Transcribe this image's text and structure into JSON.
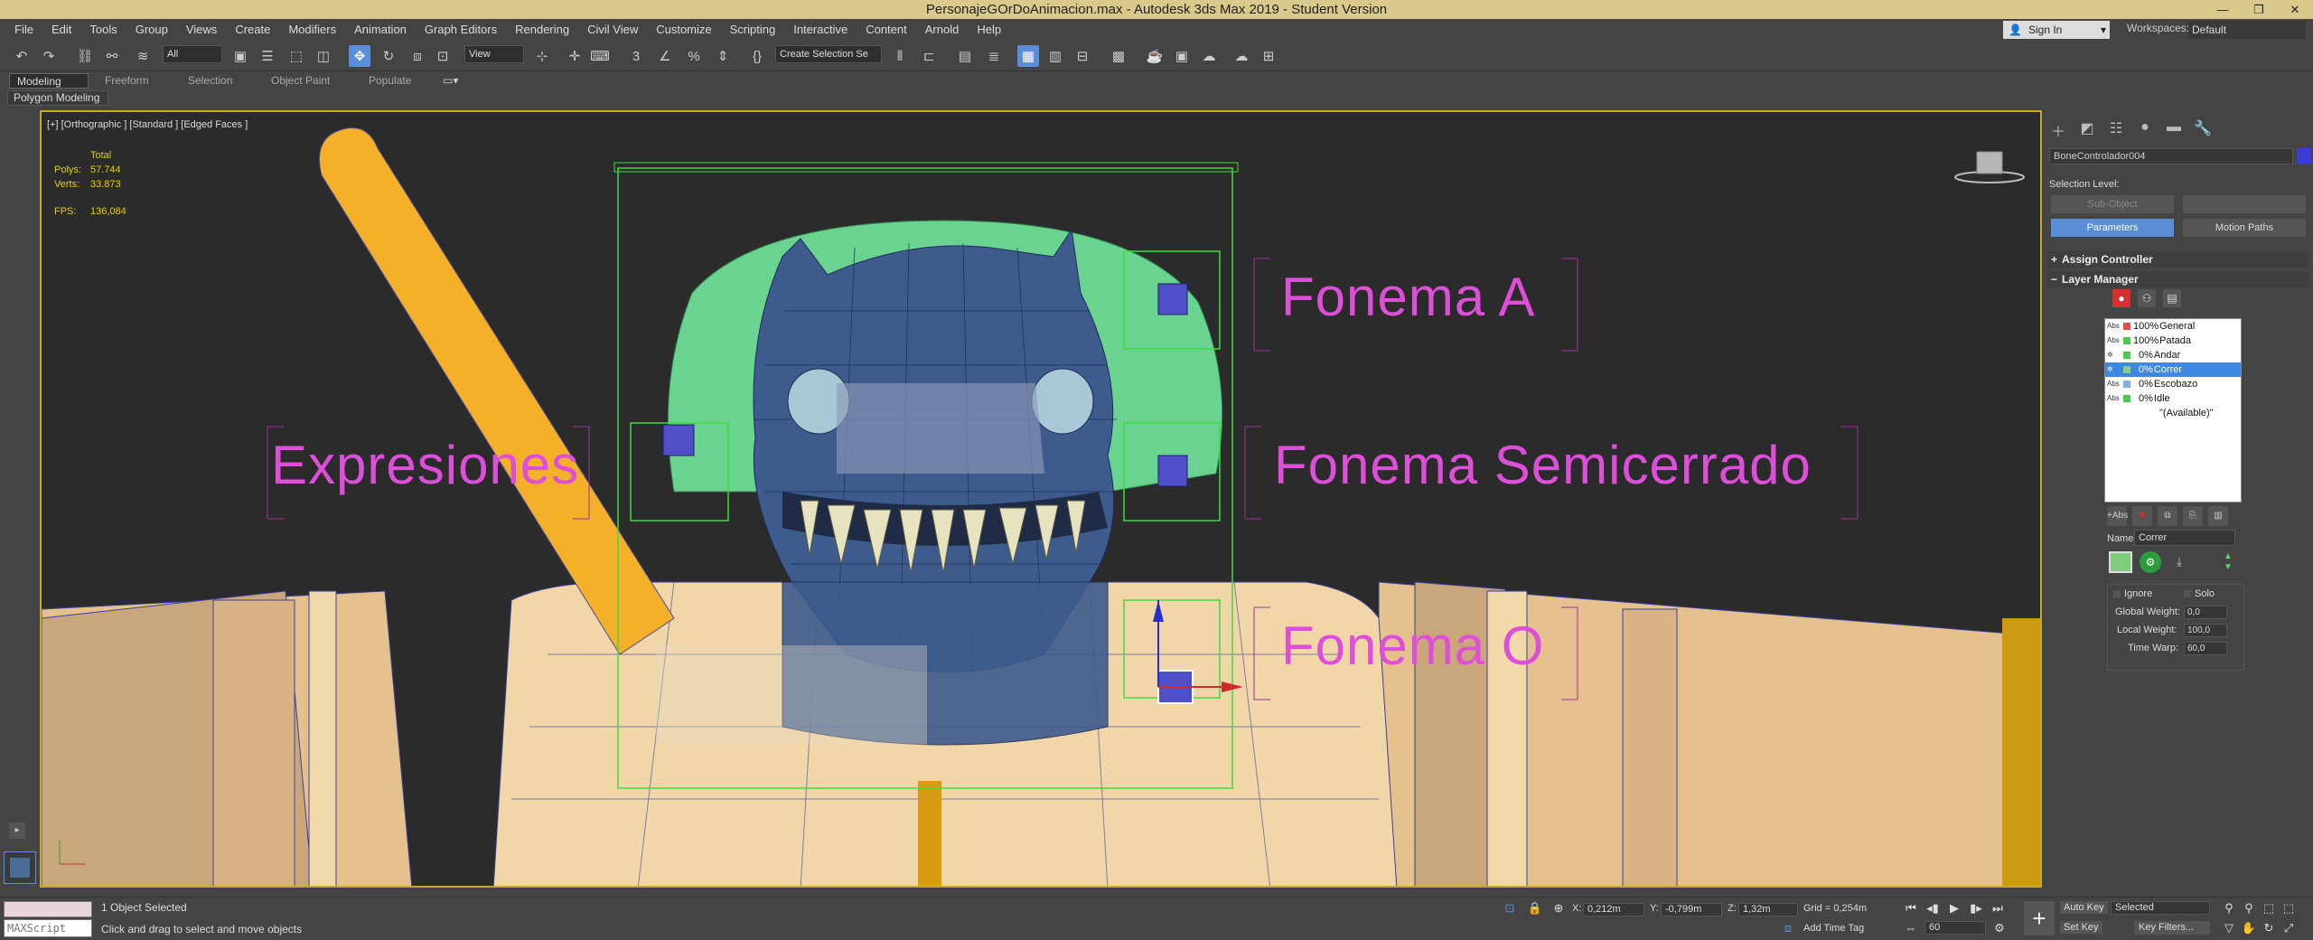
{
  "window": {
    "title": "PersonajeGOrDoAnimacion.max - Autodesk 3ds Max 2019 - Student Version",
    "controls": [
      "—",
      "❐",
      "✕"
    ]
  },
  "menu": [
    "File",
    "Edit",
    "Tools",
    "Group",
    "Views",
    "Create",
    "Modifiers",
    "Animation",
    "Graph Editors",
    "Rendering",
    "Civil View",
    "Customize",
    "Scripting",
    "Interactive",
    "Content",
    "Arnold",
    "Help"
  ],
  "account": {
    "sign_in": "Sign In",
    "workspaces_label": "Workspaces:",
    "workspace": "Default"
  },
  "toolbar": {
    "filter": "All",
    "ref_coord": "View",
    "selection_set": "Create Selection Se"
  },
  "ribbon": {
    "tabs": [
      "Modeling",
      "Freeform",
      "Selection",
      "Object Paint",
      "Populate"
    ],
    "active": "Modeling",
    "sub": "Polygon Modeling"
  },
  "viewport": {
    "label": "[+] [Orthographic ] [Standard ] [Edged Faces ]",
    "stats": {
      "total": "Total",
      "polys_label": "Polys:",
      "polys": "57.744",
      "verts_label": "Verts:",
      "verts": "33.873",
      "fps_label": "FPS:",
      "fps": "136,084"
    },
    "labels": {
      "fonema_a": "Fonema A",
      "expresiones": "Expresiones",
      "fonema_semi": "Fonema Semicerrado",
      "fonema_o": "Fonema O"
    }
  },
  "command_panel": {
    "object_name": "BoneControlador004",
    "selection_level": "Selection Level:",
    "sub_object": "Sub-Object",
    "parameters": "Parameters",
    "motion_paths": "Motion Paths",
    "assign_controller": "Assign Controller",
    "layer_manager": "Layer Manager",
    "layers": [
      {
        "pct": "100%",
        "name": "General",
        "color": "#e05050",
        "sel": false
      },
      {
        "pct": "100%",
        "name": "Patada",
        "color": "#50c850",
        "sel": false
      },
      {
        "pct": "0%",
        "name": "Andar",
        "color": "#50c850",
        "sel": false
      },
      {
        "pct": "0%",
        "name": "Correr",
        "color": "#80d080",
        "sel": true
      },
      {
        "pct": "0%",
        "name": "Escobazo",
        "color": "#80b0e0",
        "sel": false
      },
      {
        "pct": "0%",
        "name": "Idle",
        "color": "#50c850",
        "sel": false
      },
      {
        "pct": "",
        "name": "\"(Available)\"",
        "color": "",
        "sel": false
      }
    ],
    "name_label": "Name:",
    "name_value": "Correr",
    "ignore": "Ignore",
    "solo": "Solo",
    "global_weight_label": "Global Weight:",
    "global_weight": "0,0",
    "local_weight_label": "Local Weight:",
    "local_weight": "100,0",
    "time_warp_label": "Time Warp:",
    "time_warp": "60,0"
  },
  "status": {
    "maxscript": "MAXScript Mi:",
    "selected": "1 Object Selected",
    "prompt": "Click and drag to select and move objects",
    "x_label": "X:",
    "x": "0,212m",
    "y_label": "Y:",
    "y": "-0,799m",
    "z_label": "Z:",
    "z": "1,32m",
    "grid": "Grid = 0,254m",
    "add_time_tag": "Add Time Tag",
    "frame": "60",
    "auto_key": "Auto Key",
    "set_key": "Set Key",
    "key_mode": "Selected",
    "key_filters": "Key Filters..."
  }
}
